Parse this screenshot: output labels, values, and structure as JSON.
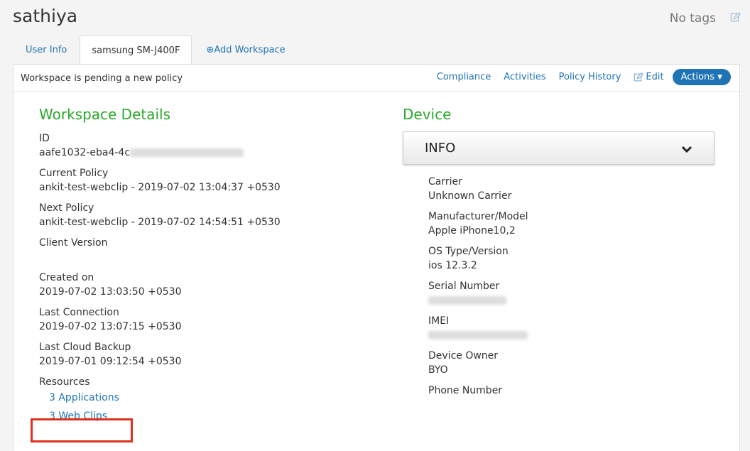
{
  "header": {
    "username": "sathiya",
    "tags": "No tags"
  },
  "tabs": [
    {
      "label": "User Info"
    },
    {
      "label": "samsung SM-J400F"
    },
    {
      "label": "Add Workspace",
      "prefix": "⊕"
    }
  ],
  "panel": {
    "status": "Workspace is pending a new policy",
    "links": {
      "compliance": "Compliance",
      "activities": "Activities",
      "policy_history": "Policy History",
      "edit": "Edit",
      "actions": "Actions"
    }
  },
  "workspace": {
    "title": "Workspace Details",
    "id_label": "ID",
    "id_value": "aafe1032-eba4-4c",
    "current_policy_label": "Current Policy",
    "current_policy_value": "ankit-test-webclip - 2019-07-02 13:04:37 +0530",
    "next_policy_label": "Next Policy",
    "next_policy_value": "ankit-test-webclip - 2019-07-02 14:54:51 +0530",
    "client_version_label": "Client Version",
    "created_label": "Created on",
    "created_value": "2019-07-02 13:03:50 +0530",
    "last_connection_label": "Last Connection",
    "last_connection_value": "2019-07-02 13:07:15 +0530",
    "last_backup_label": "Last Cloud Backup",
    "last_backup_value": "2019-07-01 09:12:54 +0530",
    "resources_label": "Resources",
    "resources": [
      "3 Applications",
      "3 Web Clips"
    ]
  },
  "device": {
    "title": "Device",
    "dropdown": "INFO",
    "carrier_label": "Carrier",
    "carrier_value": "Unknown Carrier",
    "model_label": "Manufacturer/Model",
    "model_value": "Apple iPhone10,2",
    "os_label": "OS Type/Version",
    "os_value": "ios 12.3.2",
    "serial_label": "Serial Number",
    "imei_label": "IMEI",
    "owner_label": "Device Owner",
    "owner_value": "BYO",
    "phone_label": "Phone Number"
  },
  "colors": {
    "accent": "#1f74b6",
    "section_title": "#2aa82a",
    "highlight": "#e0301e"
  }
}
